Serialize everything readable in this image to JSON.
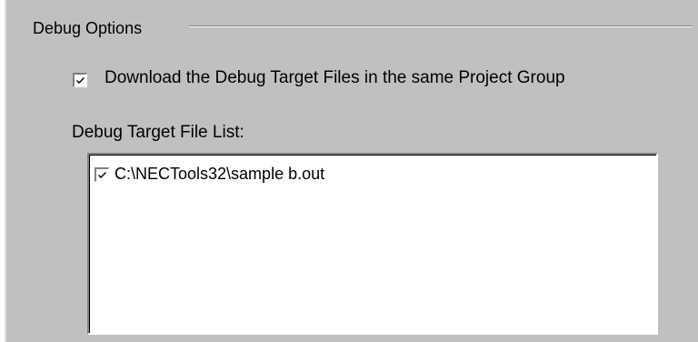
{
  "group": {
    "title": "Debug Options"
  },
  "download": {
    "label": "Download the Debug Target Files in the same Project Group",
    "checked": true
  },
  "target_list": {
    "label": "Debug Target File List:",
    "items": [
      {
        "path": "C:\\NECTools32\\sample b.out",
        "checked": true
      }
    ]
  }
}
